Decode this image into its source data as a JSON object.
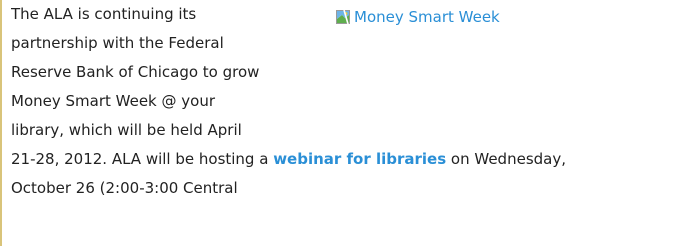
{
  "article": {
    "lines": [
      "The ALA is continuing its",
      "partnership with the Federal",
      "Reserve Bank of Chicago to grow",
      "Money Smart Week @ your",
      "library, which will be held April"
    ],
    "line6_before": "21-28, 2012.  ALA will be hosting a ",
    "line6_link": "webinar for libraries",
    "line6_after": " on Wednesday,",
    "line7": "October 26 (2:00-3:00 Central"
  },
  "image": {
    "alt_text": "Money Smart Week",
    "icon": "broken-image-icon"
  },
  "colors": {
    "link": "#2a8fd6",
    "text": "#222222",
    "rule": "#d9c47a"
  }
}
